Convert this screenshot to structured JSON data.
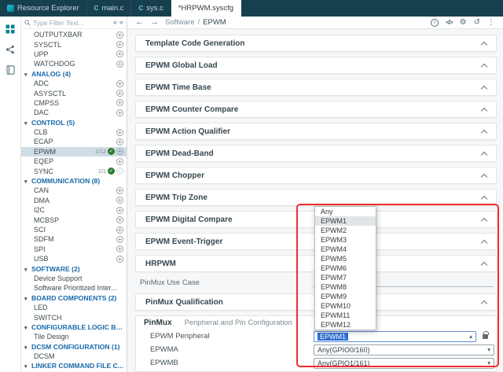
{
  "accent": {
    "red_box": "#ef2d2c",
    "selection_blue": "#2f6fd6",
    "category_blue": "#1769aa",
    "check_green": "#2e7d32"
  },
  "window": {
    "tabs": [
      {
        "label": "Resource Explorer",
        "icon": "explorer"
      },
      {
        "label": "main.c",
        "icon": "cfile"
      },
      {
        "label": "sys.c",
        "icon": "cfile"
      },
      {
        "label": "*HRPWM.syscfg",
        "active": true
      }
    ]
  },
  "activity_bar": {
    "icons": [
      "apps-icon",
      "share-icon",
      "book-icon"
    ]
  },
  "sidebar": {
    "filter_placeholder": "Type Filter Text...",
    "tree": [
      {
        "type": "leaf",
        "label": "OUTPUTXBAR",
        "add": true
      },
      {
        "type": "leaf",
        "label": "SYSCTL",
        "add": true
      },
      {
        "type": "leaf",
        "label": "UPP",
        "add": true
      },
      {
        "type": "leaf",
        "label": "WATCHDOG",
        "add": true
      },
      {
        "type": "category",
        "label": "ANALOG (4)"
      },
      {
        "type": "leaf",
        "label": "ADC",
        "add": true
      },
      {
        "type": "leaf",
        "label": "ASYSCTL",
        "add": true
      },
      {
        "type": "leaf",
        "label": "CMPSS",
        "add": true
      },
      {
        "type": "leaf",
        "label": "DAC",
        "add": true
      },
      {
        "type": "category",
        "label": "CONTROL (5)"
      },
      {
        "type": "leaf",
        "label": "CLB",
        "add": true
      },
      {
        "type": "leaf",
        "label": "ECAP",
        "add": true
      },
      {
        "type": "leaf",
        "label": "EPWM",
        "count": "1/12",
        "check": true,
        "add": true,
        "selected": true
      },
      {
        "type": "leaf",
        "label": "EQEP",
        "add": true
      },
      {
        "type": "leaf",
        "label": "SYNC",
        "count": "1/1",
        "check": true,
        "add": true,
        "addDisabled": true
      },
      {
        "type": "category",
        "label": "COMMUNICATION (8)"
      },
      {
        "type": "leaf",
        "label": "CAN",
        "add": true
      },
      {
        "type": "leaf",
        "label": "DMA",
        "add": true
      },
      {
        "type": "leaf",
        "label": "I2C",
        "add": true
      },
      {
        "type": "leaf",
        "label": "MCBSP",
        "add": true
      },
      {
        "type": "leaf",
        "label": "SCI",
        "add": true
      },
      {
        "type": "leaf",
        "label": "SDFM",
        "add": true
      },
      {
        "type": "leaf",
        "label": "SPI",
        "add": true
      },
      {
        "type": "leaf",
        "label": "USB",
        "add": true
      },
      {
        "type": "category",
        "label": "SOFTWARE (2)"
      },
      {
        "type": "leaf",
        "label": "Device Support"
      },
      {
        "type": "leaf",
        "label": "Software Prioritized Inter..."
      },
      {
        "type": "category",
        "label": "BOARD COMPONENTS (2)"
      },
      {
        "type": "leaf",
        "label": "LED"
      },
      {
        "type": "leaf",
        "label": "SWITCH"
      },
      {
        "type": "category",
        "label": "CONFIGURABLE LOGIC BL..."
      },
      {
        "type": "leaf",
        "label": "Tile Design"
      },
      {
        "type": "category",
        "label": "DCSM CONFIGURATION (1)"
      },
      {
        "type": "leaf",
        "label": "DCSM"
      },
      {
        "type": "category",
        "label": "LINKER COMMAND FILE C..."
      }
    ]
  },
  "main": {
    "breadcrumb": {
      "path": "Software",
      "sep": "/",
      "current": "EPWM"
    },
    "sections": [
      {
        "label": "Template Code Generation"
      },
      {
        "label": "EPWM Global Load"
      },
      {
        "label": "EPWM Time Base"
      },
      {
        "label": "EPWM Counter Compare"
      },
      {
        "label": "EPWM Action Qualifier"
      },
      {
        "label": "EPWM Dead-Band"
      },
      {
        "label": "EPWM Chopper"
      },
      {
        "label": "EPWM Trip Zone"
      },
      {
        "label": "EPWM Digital Compare"
      },
      {
        "label": "EPWM Event-Trigger"
      },
      {
        "label": "HRPWM"
      }
    ],
    "pinmux_use_case": {
      "label": "PinMux Use Case"
    },
    "pinmux_qualification": {
      "label": "PinMux Qualification"
    },
    "pinmux": {
      "title": "PinMux",
      "subtitle": "Peripheral and Pin Configuration",
      "fields": [
        {
          "label": "EPWM Peripheral",
          "value": "EPWM1",
          "locked": true,
          "open": true
        },
        {
          "label": "EPWMA",
          "value": "Any(GPIO0/160)"
        },
        {
          "label": "EPWMB",
          "value": "Any(GPIO1/161)"
        }
      ]
    },
    "dropdown": {
      "options": [
        "Any",
        "EPWM1",
        "EPWM2",
        "EPWM3",
        "EPWM4",
        "EPWM5",
        "EPWM6",
        "EPWM7",
        "EPWM8",
        "EPWM9",
        "EPWM10",
        "EPWM11",
        "EPWM12"
      ],
      "highlighted": "EPWM1"
    }
  }
}
